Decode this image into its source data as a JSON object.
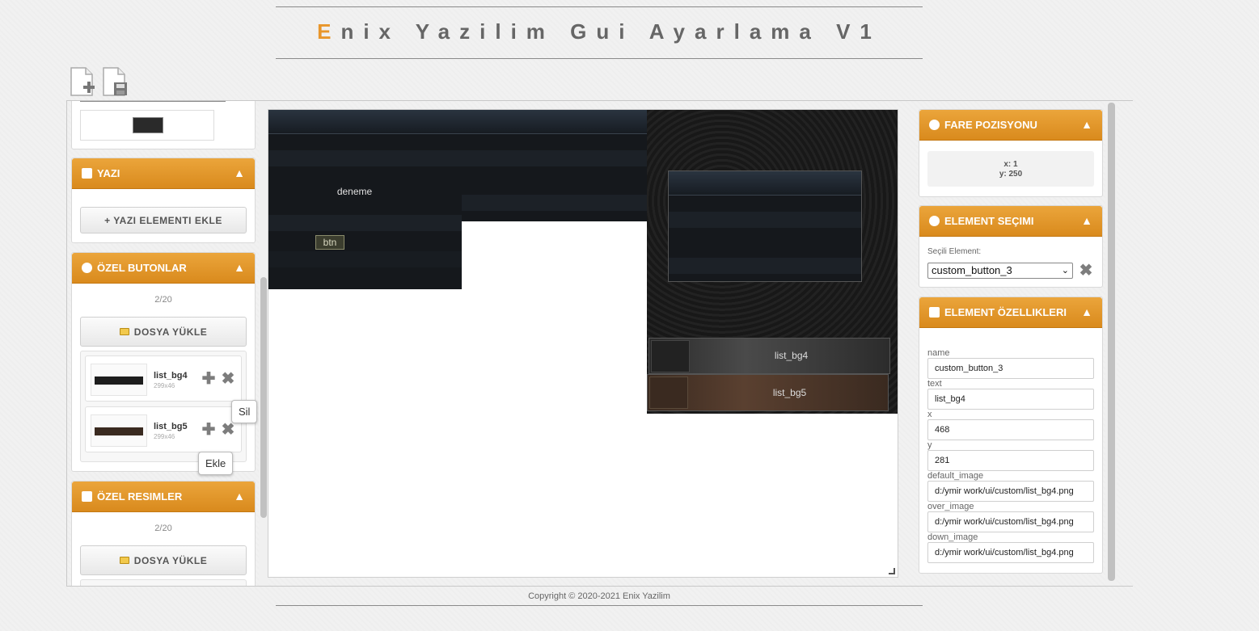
{
  "header": {
    "title_accent": "E",
    "title_rest": "nix Yazilim Gui Ayarlama V1"
  },
  "toolbar": {
    "new_icon": "new-file-icon",
    "save_icon": "save-file-icon"
  },
  "left_panel": {
    "yazi": {
      "title": "YAZI",
      "add_button": "+ YAZI ELEMENTI EKLE"
    },
    "ozel_butonlar": {
      "title": "ÖZEL BUTONLAR",
      "count": "2/20",
      "upload_button": "DOSYA YÜKLE",
      "items": [
        {
          "name": "list_bg4",
          "size": "299x46"
        },
        {
          "name": "list_bg5",
          "size": "299x46"
        }
      ]
    },
    "ozel_resimler": {
      "title": "ÖZEL RESIMLER",
      "count": "2/20",
      "upload_button": "DOSYA YÜKLE"
    },
    "tooltips": {
      "sil": "Sil",
      "ekle": "Ekle"
    }
  },
  "canvas": {
    "window1_text": "deneme",
    "window1_button": "btn",
    "list_button_1": "list_bg4",
    "list_button_2": "list_bg5"
  },
  "right_panel": {
    "fare": {
      "title": "FARE POZISYONU",
      "x_text": "x: 1",
      "y_text": "y: 250"
    },
    "secim": {
      "title": "ELEMENT SEÇIMI",
      "label": "Seçili Element:",
      "selected": "custom_button_3"
    },
    "ozellikler": {
      "title": "ELEMENT ÖZELLIKLERI",
      "fields": [
        {
          "label": "name",
          "value": "custom_button_3"
        },
        {
          "label": "text",
          "value": "list_bg4"
        },
        {
          "label": "x",
          "value": "468"
        },
        {
          "label": "y",
          "value": "281"
        },
        {
          "label": "default_image",
          "value": "d:/ymir work/ui/custom/list_bg4.png"
        },
        {
          "label": "over_image",
          "value": "d:/ymir work/ui/custom/list_bg4.png"
        },
        {
          "label": "down_image",
          "value": "d:/ymir work/ui/custom/list_bg4.png"
        }
      ]
    }
  },
  "footer": {
    "copyright": "Copyright © 2020-2021 Enix Yazilim"
  },
  "colors": {
    "accent": "#e8962b",
    "panel_header": "#e09a2e"
  }
}
